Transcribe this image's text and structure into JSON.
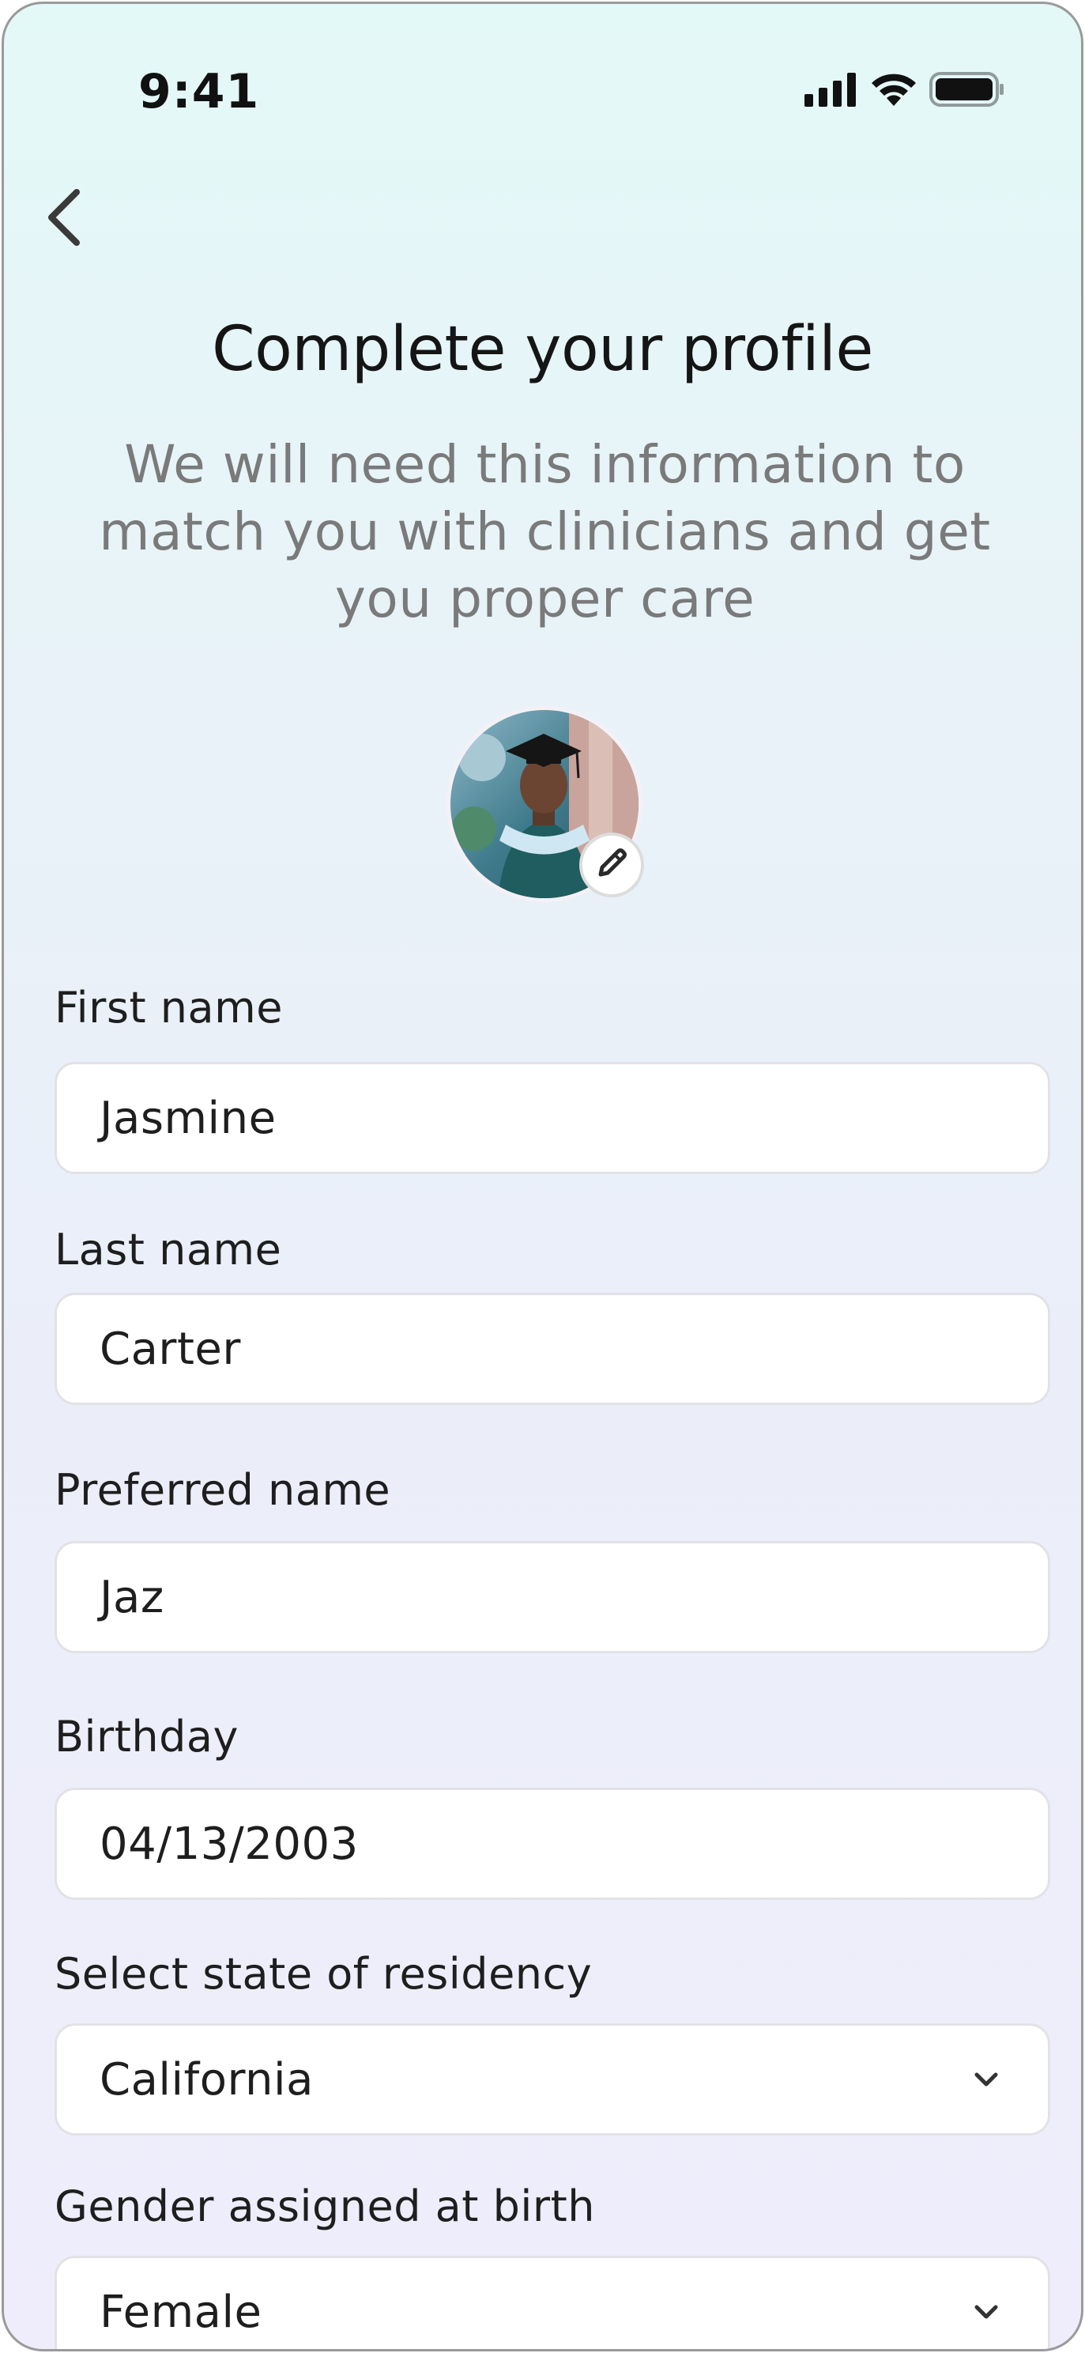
{
  "status_bar": {
    "time": "9:41",
    "icons": [
      "cellular-signal-icon",
      "wifi-icon",
      "battery-icon"
    ]
  },
  "header": {
    "back_icon": "chevron-left-icon",
    "title": "Complete your profile",
    "subtitle": "We will need this information to match you with clinicians and get you proper care"
  },
  "avatar": {
    "edit_icon": "pencil-icon"
  },
  "form": {
    "first_name": {
      "label": "First name",
      "value": "Jasmine"
    },
    "last_name": {
      "label": "Last name",
      "value": "Carter"
    },
    "preferred_name": {
      "label": "Preferred name",
      "value": "Jaz"
    },
    "birthday": {
      "label": "Birthday",
      "value": "04/13/2003"
    },
    "state": {
      "label": "Select state of residency",
      "value": "California"
    },
    "gender": {
      "label": "Gender assigned at birth",
      "value": "Female"
    }
  },
  "colors": {
    "background_top": "#e3f9f7",
    "background_bottom": "#efedfb",
    "input_background": "#ffffff",
    "input_border": "#e2e2e6",
    "subtitle_text": "#7a7a7a"
  }
}
